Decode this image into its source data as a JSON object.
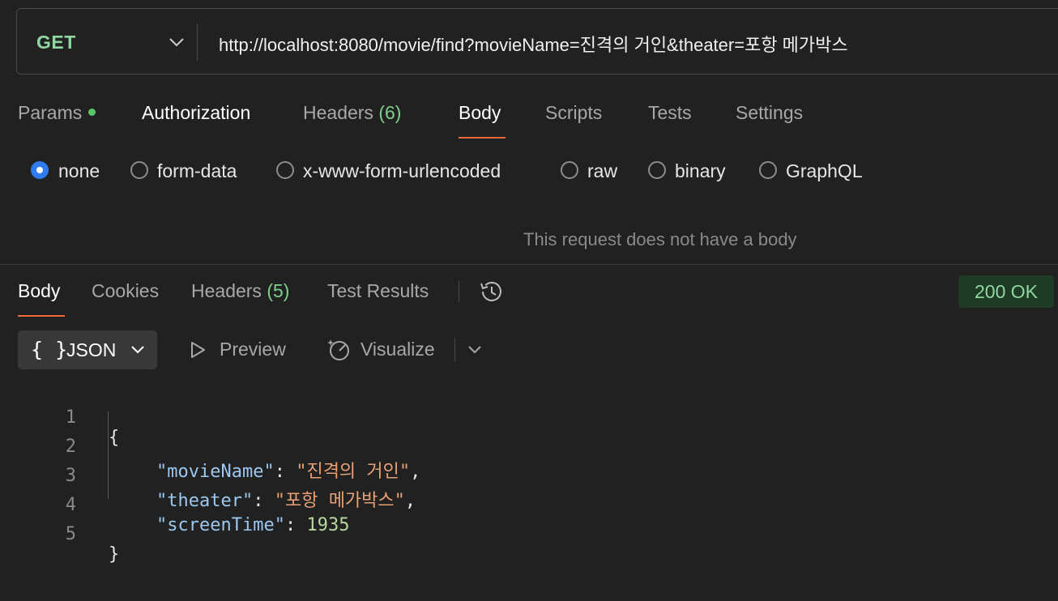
{
  "request": {
    "method": "GET",
    "url": "http://localhost:8080/movie/find?movieName=진격의 거인&theater=포항 메가박스"
  },
  "request_tabs": {
    "params": "Params",
    "authorization": "Authorization",
    "headers": "Headers",
    "headers_count": "(6)",
    "body": "Body",
    "scripts": "Scripts",
    "tests": "Tests",
    "settings": "Settings",
    "active": "Body"
  },
  "body_types": {
    "none": "none",
    "form_data": "form-data",
    "urlencoded": "x-www-form-urlencoded",
    "raw": "raw",
    "binary": "binary",
    "graphql": "GraphQL",
    "selected": "none"
  },
  "no_body_message": "This request does not have a body",
  "response_tabs": {
    "body": "Body",
    "cookies": "Cookies",
    "headers": "Headers",
    "headers_count": "(5)",
    "test_results": "Test Results",
    "active": "Body"
  },
  "status": "200 OK",
  "response_toolbar": {
    "format_braces": "{ }",
    "format": "JSON",
    "preview": "Preview",
    "visualize": "Visualize"
  },
  "response_body": {
    "line_numbers": [
      "1",
      "2",
      "3",
      "4",
      "5"
    ],
    "open_brace": "{",
    "close_brace": "}",
    "fields": [
      {
        "key": "\"movieName\"",
        "value": "\"진격의 거인\"",
        "trail": ","
      },
      {
        "key": "\"theater\"",
        "value": "\"포항 메가박스\"",
        "trail": ","
      },
      {
        "key": "\"screenTime\"",
        "value": "1935",
        "trail": ""
      }
    ]
  },
  "colors": {
    "background": "#212121",
    "method_green": "#8fd6a0",
    "accent_orange": "#ef6c3a",
    "radio_blue": "#2f7cf0",
    "json_key": "#9cc8f0",
    "json_string": "#e8a074",
    "json_number": "#b8d8a0"
  }
}
